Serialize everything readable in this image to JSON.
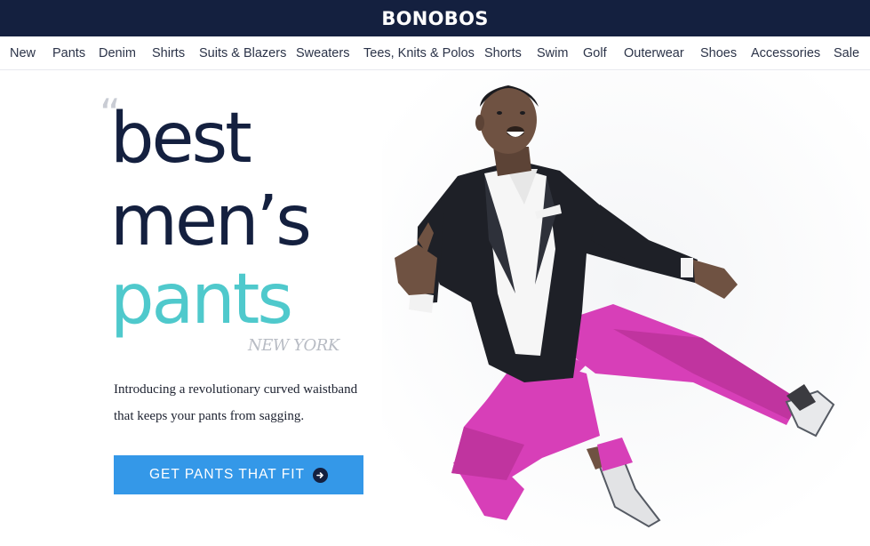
{
  "header": {
    "logo": "BONOBOS"
  },
  "nav": {
    "items": [
      "New",
      "Pants",
      "Denim",
      "Shirts",
      "Suits & Blazers",
      "Sweaters",
      "Tees, Knits & Polos",
      "Shorts",
      "Swim",
      "Golf",
      "Outerwear",
      "Shoes",
      "Accessories",
      "Sale"
    ]
  },
  "hero": {
    "quote_mark": "“",
    "headline": [
      "best",
      "men’s",
      "pants"
    ],
    "source": "NEW YORK",
    "subtext": [
      "Introducing a revolutionary curved waistband",
      "that keeps your pants from sagging."
    ],
    "cta_label": "GET PANTS THAT FIT",
    "cta_icon": "arrow-right-circle-icon",
    "photo_subject": "man-jumping-in-pink-pants"
  },
  "colors": {
    "navbar_bg": "#14203f",
    "headline_navy": "#14203f",
    "headline_teal": "#4fc9cc",
    "cta_blue": "#3498e8",
    "pants_pink": "#d73fb8"
  }
}
